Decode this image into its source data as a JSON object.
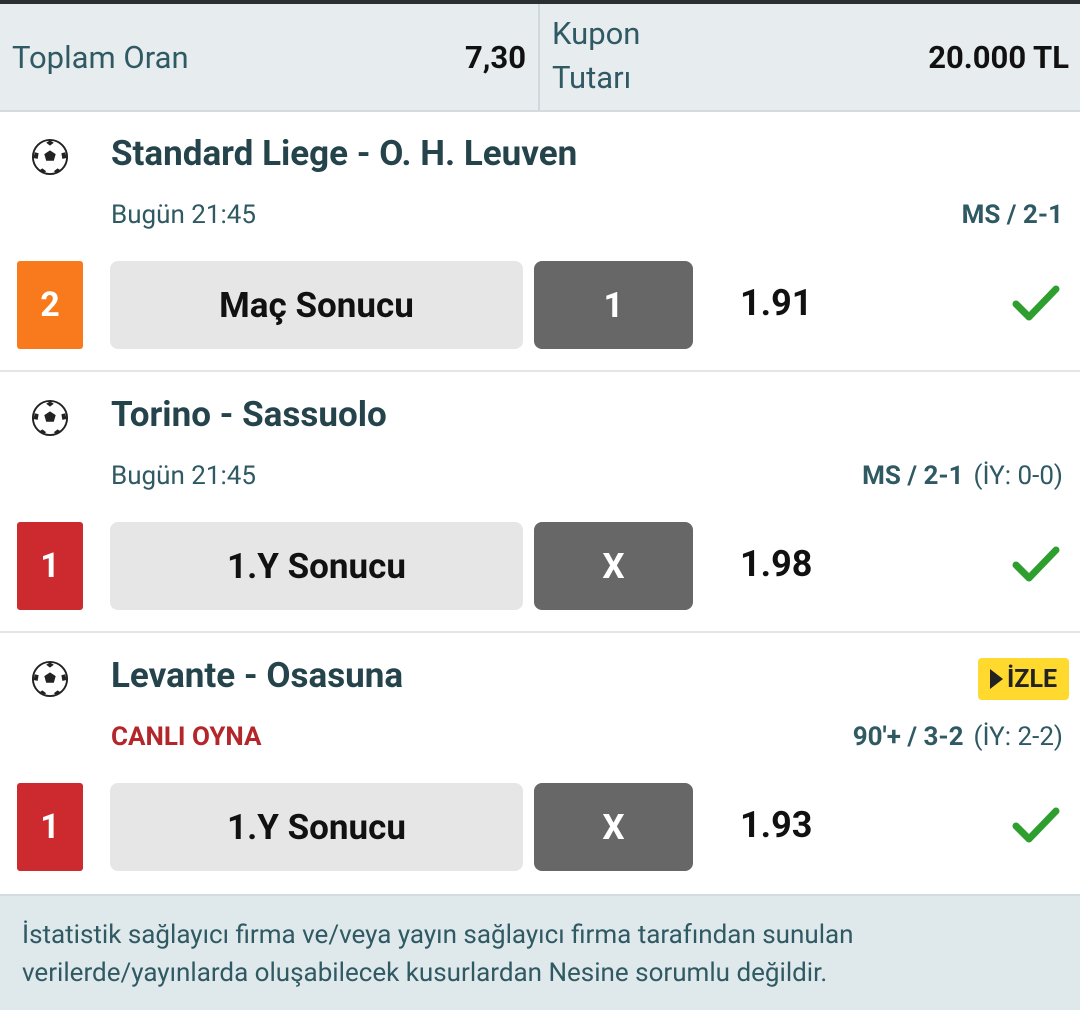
{
  "summary": {
    "total_odds_label": "Toplam Oran",
    "total_odds_value": "7,30",
    "coupon_amount_label_line1": "Kupon",
    "coupon_amount_label_line2": "Tutarı",
    "coupon_amount_value": "20.000 TL"
  },
  "events": [
    {
      "sport_icon": "soccer-ball-icon",
      "teams": "Standard Liege - O. H. Leuven",
      "time": "Bugün 21:45",
      "result": "MS / 2-1",
      "half_time": "",
      "mbs": "2",
      "market": "Maç Sonucu",
      "pick": "1",
      "odd": "1.91",
      "status_icon": "check-icon"
    },
    {
      "sport_icon": "soccer-ball-icon",
      "teams": "Torino - Sassuolo",
      "time": "Bugün 21:45",
      "result": "MS / 2-1",
      "half_time": "(İY: 0-0)",
      "mbs": "1",
      "market": "1.Y Sonucu",
      "pick": "X",
      "odd": "1.98",
      "status_icon": "check-icon"
    },
    {
      "sport_icon": "soccer-ball-icon",
      "teams": "Levante - Osasuna",
      "live_label": "CANLI OYNA",
      "watch_label": "İZLE",
      "result": "90'+ / 3-2",
      "half_time": "(İY: 2-2)",
      "mbs": "1",
      "market": "1.Y Sonucu",
      "pick": "X",
      "odd": "1.93",
      "status_icon": "check-icon"
    }
  ],
  "colors": {
    "badge_orange": "#f97a1d",
    "badge_red": "#cc2a2e",
    "check_green": "#2e9e2e",
    "live_red": "#b3262a",
    "watch_yellow": "#ffd92e"
  },
  "disclaimer": "İstatistik sağlayıcı firma ve/veya yayın sağlayıcı firma tarafından sunulan verilerde/yayınlarda oluşabilecek kusurlardan Nesine sorumlu değildir."
}
